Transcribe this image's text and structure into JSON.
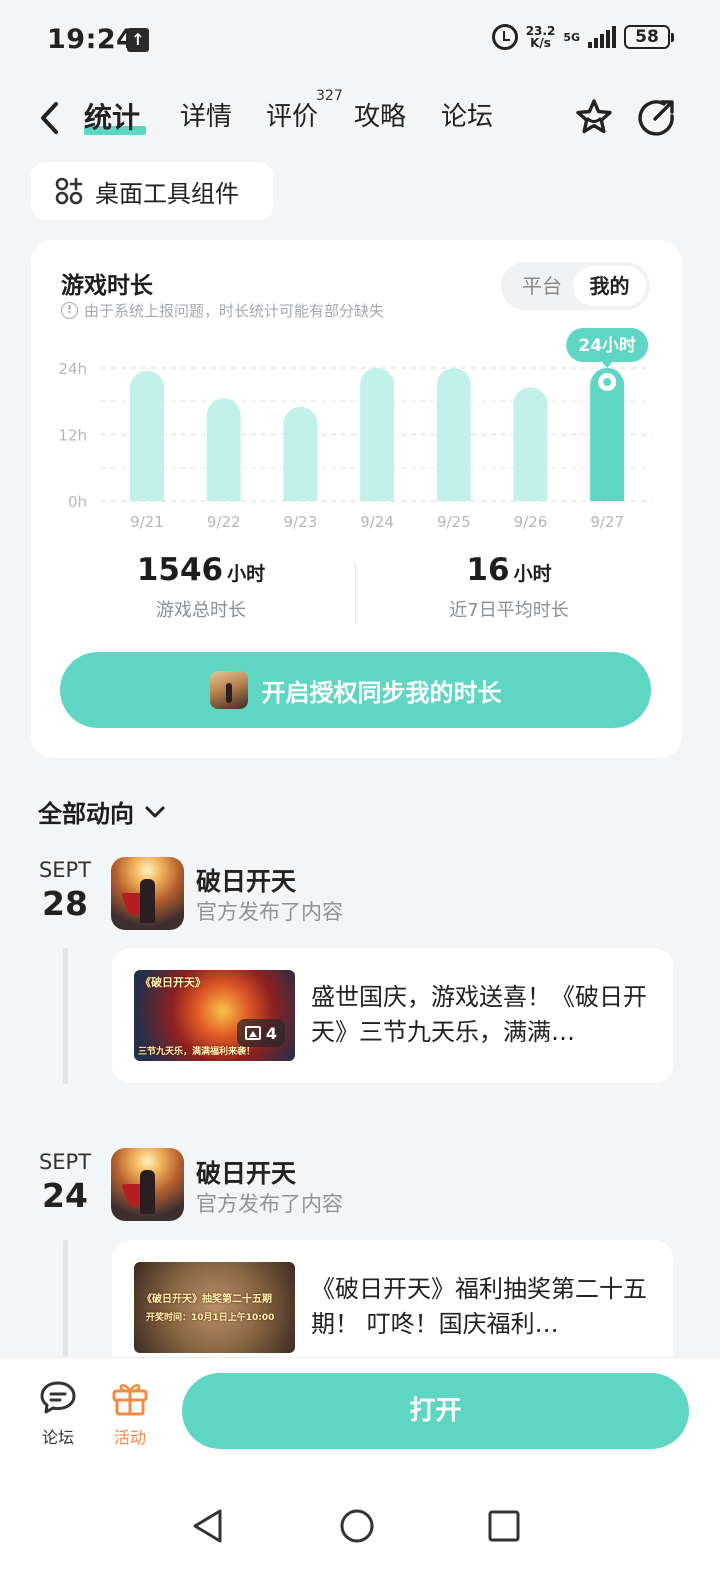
{
  "status_bar": {
    "time": "19:24",
    "net_speed_value": "23.2",
    "net_speed_unit": "K/s",
    "network": "5G",
    "battery": "58"
  },
  "nav": {
    "tabs": [
      {
        "label": "统计",
        "active": true
      },
      {
        "label": "详情"
      },
      {
        "label": "评价",
        "badge": "327"
      },
      {
        "label": "攻略"
      },
      {
        "label": "论坛"
      }
    ]
  },
  "widget_chip": {
    "label": "桌面工具组件"
  },
  "playtime": {
    "title": "游戏时长",
    "note": "由于系统上报问题，时长统计可能有部分缺失",
    "toggle": {
      "options": [
        "平台",
        "我的"
      ],
      "selected": "我的"
    },
    "highlight_label": "24小时",
    "total_value": "1546",
    "total_unit": "小时",
    "total_label": "游戏总时长",
    "avg_value": "16",
    "avg_unit": "小时",
    "avg_label": "近7日平均时长",
    "sync_button": "开启授权同步我的时长"
  },
  "chart_data": {
    "type": "bar",
    "categories": [
      "9/21",
      "9/22",
      "9/23",
      "9/24",
      "9/25",
      "9/26",
      "9/27"
    ],
    "values": [
      23.5,
      18.5,
      17,
      24,
      24,
      20.5,
      24
    ],
    "ylim": [
      0,
      24
    ],
    "y_ticks": [
      "24h",
      "12h",
      "0h"
    ],
    "grid": true,
    "highlight_index": 6,
    "colors": {
      "bar": "#c2f1ea",
      "highlight": "#5fd6c4"
    }
  },
  "feed": {
    "filter_label": "全部动向",
    "items": [
      {
        "month": "SEPT",
        "day": "28",
        "game": "破日开天",
        "action": "官方发布了内容",
        "thumb_caption_top": "《破日开天》",
        "thumb_caption_bottom": "三节九天乐，满满福利来袭！",
        "image_count": "4",
        "text": "盛世国庆，游戏送喜！《破日开天》三节九天乐，满满…"
      },
      {
        "month": "SEPT",
        "day": "24",
        "game": "破日开天",
        "action": "官方发布了内容",
        "thumb_caption_top": "《破日开天》抽奖第二十五期",
        "thumb_caption_bottom": "开奖时间：10月1日上午10:00",
        "text": "《破日开天》福利抽奖第二十五期！ 叮咚！国庆福利…"
      }
    ]
  },
  "bottom": {
    "forum_label": "论坛",
    "activity_label": "活动",
    "open_button": "打开"
  },
  "colors": {
    "accent": "#5fd6c4",
    "activity": "#f08a45"
  }
}
